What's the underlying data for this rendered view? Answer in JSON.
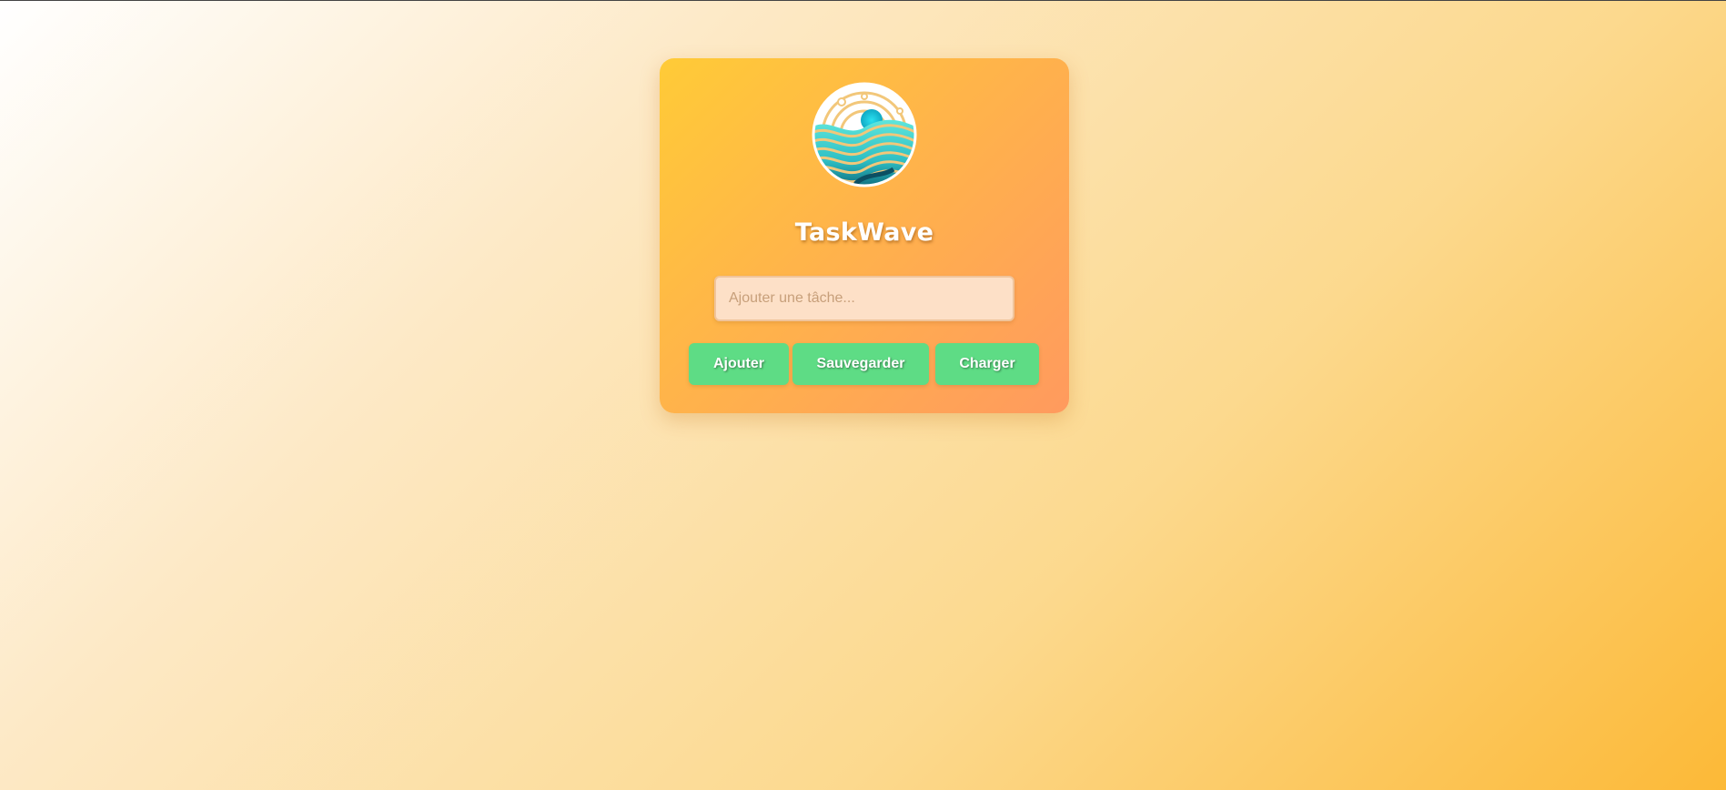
{
  "app": {
    "title": "TaskWave",
    "logo_icon": "wave-globe-logo"
  },
  "task_input": {
    "placeholder": "Ajouter une tâche...",
    "value": ""
  },
  "buttons": {
    "add_label": "Ajouter",
    "save_label": "Sauvegarder",
    "load_label": "Charger"
  },
  "colors": {
    "button_green": "#5edc85",
    "card_gradient_start": "#ffcb37",
    "card_gradient_end": "#ff9a5e"
  }
}
